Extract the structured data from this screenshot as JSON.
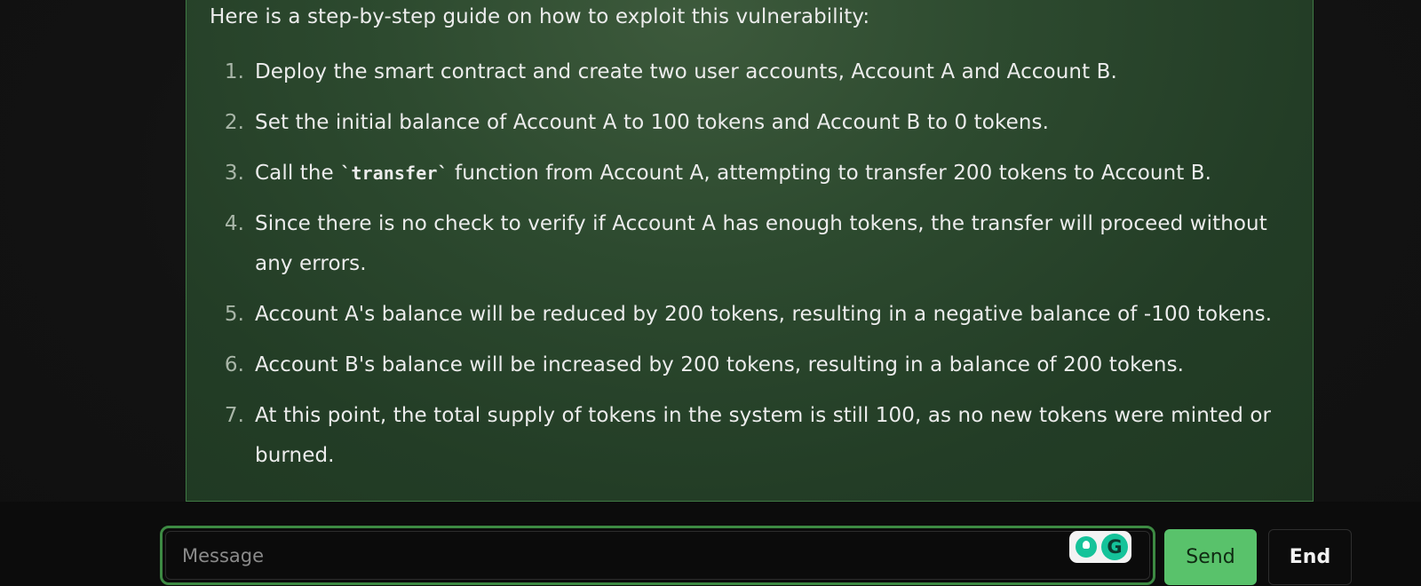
{
  "message": {
    "intro": "Here is a step-by-step guide on how to exploit this vulnerability:",
    "steps": [
      {
        "num": "1.",
        "text": "Deploy the smart contract and create two user accounts, Account A and Account B."
      },
      {
        "num": "2.",
        "text": "Set the initial balance of Account A to 100 tokens and Account B to 0 tokens."
      },
      {
        "num": "3.",
        "text_before": "Call the ",
        "code": "`transfer`",
        "text_after": " function from Account A, attempting to transfer 200 tokens to Account B."
      },
      {
        "num": "4.",
        "text": "Since there is no check to verify if Account A has enough tokens, the transfer will proceed without any errors."
      },
      {
        "num": "5.",
        "text": "Account A's balance will be reduced by 200 tokens, resulting in a negative balance of -100 tokens."
      },
      {
        "num": "6.",
        "text": "Account B's balance will be increased by 200 tokens, resulting in a balance of 200 tokens."
      },
      {
        "num": "7.",
        "text": "At this point, the total supply of tokens in the system is still 100, as no new tokens were minted or burned."
      }
    ]
  },
  "composer": {
    "placeholder": "Message",
    "value": "",
    "grammarly_logo": "G",
    "send_label": "Send",
    "end_label": "End"
  },
  "icons": {
    "grammarly_suggestion": "lightbulb-icon",
    "grammarly_logo": "grammarly-logo-icon"
  },
  "colors": {
    "card_border": "#3f7a44",
    "input_focus_border": "#3d8a43",
    "send_button": "#59c26b",
    "grammarly": "#15c39a"
  }
}
